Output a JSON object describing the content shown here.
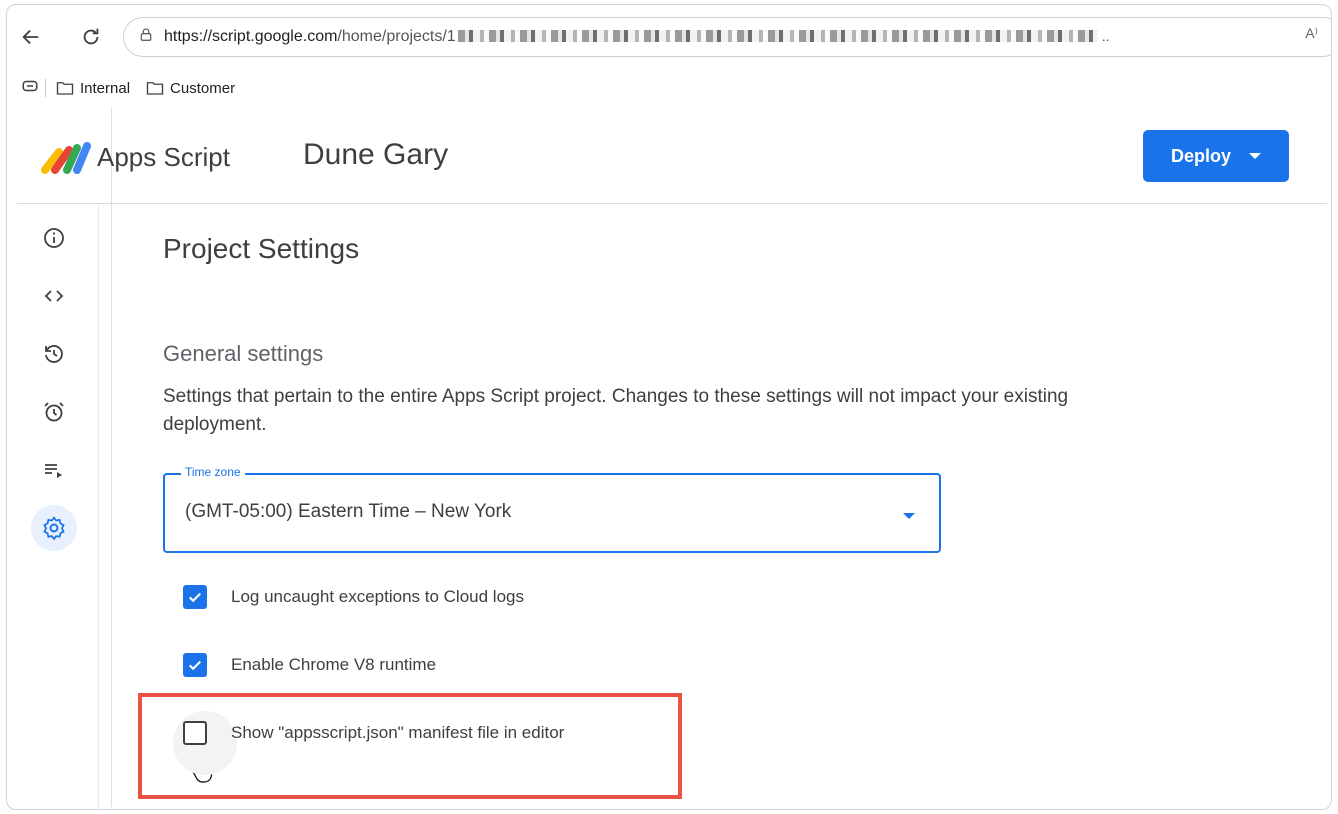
{
  "browser": {
    "url_prefix": "https://",
    "url_host": "script.google.com",
    "url_path": "/home/projects/1",
    "url_ellipsis": "..",
    "read_aloud": "A⁾",
    "icons": [
      "back-arrow-icon",
      "reload-icon",
      "site-info-icon",
      "read-aloud-icon"
    ],
    "bookmarks": [
      {
        "label": "Internal",
        "icon": "folder-icon"
      },
      {
        "label": "Customer",
        "icon": "folder-icon"
      }
    ]
  },
  "app": {
    "brand": "Apps Script",
    "project_name": "Dune Gary",
    "deploy_label": "Deploy",
    "rail": [
      {
        "name": "overview",
        "icon": "info-icon",
        "active": false
      },
      {
        "name": "editor",
        "icon": "code-icon",
        "active": false
      },
      {
        "name": "executions-history",
        "icon": "history-icon",
        "active": false
      },
      {
        "name": "triggers",
        "icon": "alarm-icon",
        "active": false
      },
      {
        "name": "executions",
        "icon": "playlist-play-icon",
        "active": false
      },
      {
        "name": "project-settings",
        "icon": "gear-icon",
        "active": true
      }
    ]
  },
  "settings": {
    "page_title": "Project Settings",
    "section_title": "General settings",
    "description": "Settings that pertain to the entire Apps Script project. Changes to these settings will not impact your existing deployment.",
    "time_zone": {
      "label": "Time zone",
      "value": "(GMT-05:00) Eastern Time – New York"
    },
    "options": [
      {
        "label": "Log uncaught exceptions to Cloud logs",
        "checked": true
      },
      {
        "label": "Enable Chrome V8 runtime",
        "checked": true
      },
      {
        "label": "Show \"appsscript.json\" manifest file in editor",
        "checked": false
      }
    ]
  },
  "colors": {
    "accent": "#1a73e8",
    "highlight_box": "#ea5245"
  }
}
